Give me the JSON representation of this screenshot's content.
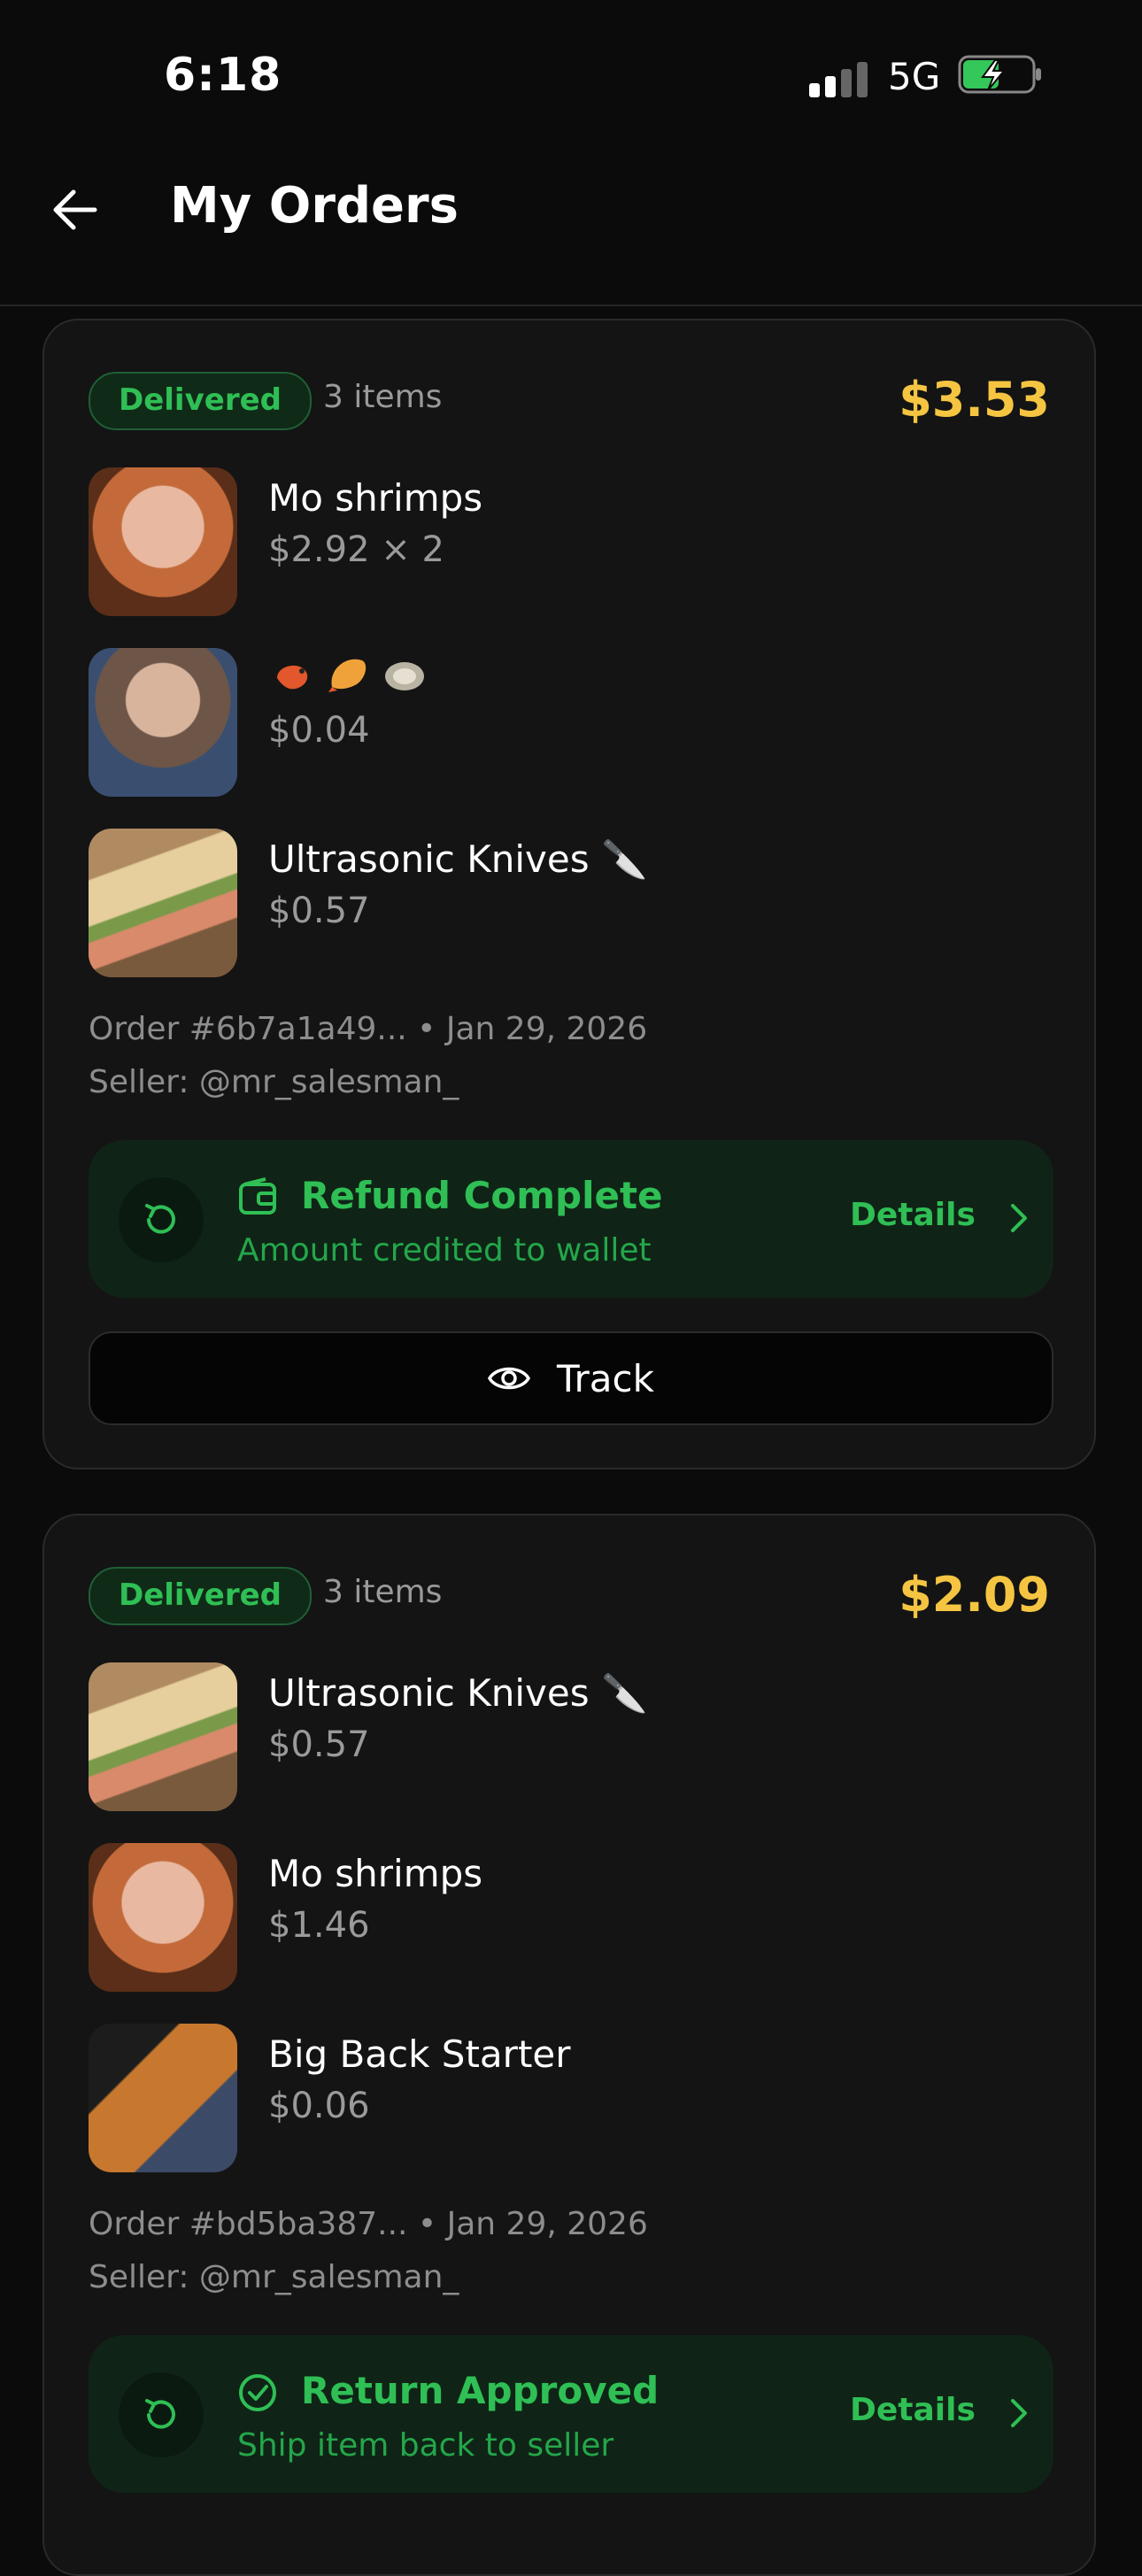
{
  "status_bar": {
    "time": "6:18",
    "network": "5G"
  },
  "header": {
    "title": "My Orders"
  },
  "orders": [
    {
      "status": "Delivered",
      "items_count": "3 items",
      "total": "$3.53",
      "items": [
        {
          "title": "Mo shrimps",
          "price": "$2.92 × 2"
        },
        {
          "title": "",
          "price": "$0.04",
          "icons": [
            "shrimp-emoji",
            "fried-shrimp-emoji",
            "oyster-emoji"
          ]
        },
        {
          "title": "Ultrasonic Knives 🔪",
          "price": "$0.57"
        }
      ],
      "order_line": "Order #6b7a1a49... • Jan 29, 2026",
      "seller_line": "Seller: @mr_salesman_",
      "refund": {
        "title": "Refund Complete",
        "subtitle": "Amount credited to wallet",
        "details": "Details"
      },
      "track_label": "Track"
    },
    {
      "status": "Delivered",
      "items_count": "3 items",
      "total": "$2.09",
      "items": [
        {
          "title": "Ultrasonic Knives 🔪",
          "price": "$0.57"
        },
        {
          "title": "Mo shrimps",
          "price": "$1.46"
        },
        {
          "title": "Big Back Starter",
          "price": "$0.06"
        }
      ],
      "order_line": "Order #bd5ba387... • Jan 29, 2026",
      "seller_line": "Seller: @mr_salesman_",
      "refund": {
        "title": "Return Approved",
        "subtitle": "Ship item back to seller",
        "details": "Details"
      }
    }
  ],
  "colors": {
    "accent_green": "#2fbf55",
    "price_yellow": "#f5c542",
    "background": "#0b0b0b"
  }
}
